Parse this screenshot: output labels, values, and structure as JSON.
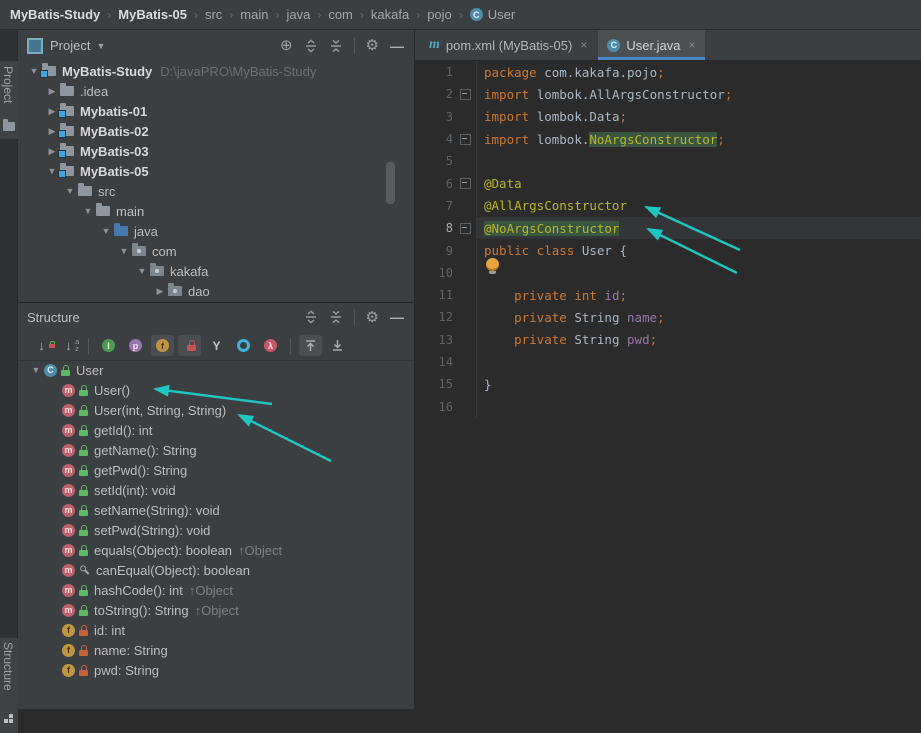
{
  "colors": {
    "accent_underline": "#4A88C7",
    "annotation_arrow": "#1EC5C1",
    "usage_highlight_bg": "#38573E",
    "keyword": "#CC7832",
    "annotation": "#BBB529",
    "field": "#9876AA"
  },
  "titlebar": {
    "breadcrumbs": [
      {
        "label": "MyBatis-Study",
        "bold": true
      },
      {
        "label": "MyBatis-05",
        "bold": true
      },
      {
        "label": "src"
      },
      {
        "label": "main"
      },
      {
        "label": "java"
      },
      {
        "label": "com"
      },
      {
        "label": "kakafa"
      },
      {
        "label": "pojo"
      },
      {
        "label": "User",
        "icon": "class"
      }
    ]
  },
  "tool_stripe": {
    "top_tab": "Project",
    "bottom_tab": "Structure"
  },
  "project_panel": {
    "title": "Project",
    "header_icons": [
      "locate-icon",
      "expand-all-icon",
      "collapse-all-icon",
      "separator",
      "settings-icon",
      "hide-icon"
    ],
    "tree": [
      {
        "label": "MyBatis-Study",
        "suffix": "D:\\javaPRO\\MyBatis-Study",
        "icon": "module",
        "state": "expanded",
        "level": 0,
        "bold": true
      },
      {
        "label": ".idea",
        "icon": "folder",
        "state": "collapsed",
        "level": 1
      },
      {
        "label": "Mybatis-01",
        "icon": "module",
        "state": "collapsed",
        "level": 1,
        "bold": true
      },
      {
        "label": "MyBatis-02",
        "icon": "module",
        "state": "collapsed",
        "level": 1,
        "bold": true
      },
      {
        "label": "MyBatis-03",
        "icon": "module",
        "state": "collapsed",
        "level": 1,
        "bold": true
      },
      {
        "label": "MyBatis-05",
        "icon": "module",
        "state": "expanded",
        "level": 1,
        "bold": true
      },
      {
        "label": "src",
        "icon": "folder",
        "state": "expanded",
        "level": 2
      },
      {
        "label": "main",
        "icon": "folder",
        "state": "expanded",
        "level": 3
      },
      {
        "label": "java",
        "icon": "source-folder",
        "state": "expanded",
        "level": 4
      },
      {
        "label": "com",
        "icon": "package",
        "state": "expanded",
        "level": 5
      },
      {
        "label": "kakafa",
        "icon": "package",
        "state": "expanded",
        "level": 6
      },
      {
        "label": "dao",
        "icon": "package",
        "state": "collapsed",
        "level": 7
      }
    ]
  },
  "structure_panel": {
    "title": "Structure",
    "header_icons": [
      "expand-all-icon",
      "collapse-all-icon",
      "separator",
      "settings-icon",
      "hide-icon"
    ],
    "toolbar": [
      {
        "name": "sort-by-visibility-icon",
        "kind": "sort-vis"
      },
      {
        "name": "sort-alphabetically-icon",
        "kind": "sort-az"
      },
      {
        "name": "separator",
        "kind": "sep"
      },
      {
        "name": "show-inherited-icon",
        "kind": "circle",
        "bg": "#4D9B53",
        "letter": "I",
        "lc": "#E8F2E8"
      },
      {
        "name": "show-properties-icon",
        "kind": "circle",
        "bg": "#9876AA",
        "letter": "p",
        "lc": "#F0E8F5"
      },
      {
        "name": "show-fields-icon",
        "kind": "circle",
        "bg": "#C09542",
        "letter": "f",
        "lc": "#42310B",
        "toggled": true
      },
      {
        "name": "show-non-public-icon",
        "kind": "lock",
        "toggled": true
      },
      {
        "name": "show-anonymous-classes-icon",
        "kind": "y"
      },
      {
        "name": "show-open-classes-icon",
        "kind": "donut"
      },
      {
        "name": "show-lambdas-icon",
        "kind": "circle",
        "bg": "#C8576C",
        "letter": "λ",
        "lc": "#F7E3E8"
      },
      {
        "name": "separator",
        "kind": "sep"
      },
      {
        "name": "autoscroll-to-source-icon",
        "kind": "bar-up",
        "toggled": true
      },
      {
        "name": "autoscroll-from-source-icon",
        "kind": "bar-down"
      }
    ],
    "tree": [
      {
        "label": "User",
        "icon": "class",
        "vis": "public",
        "state": "expanded",
        "level": 0
      },
      {
        "label": "User()",
        "icon": "method",
        "vis": "public",
        "level": 1
      },
      {
        "label": "User(int, String, String)",
        "icon": "method",
        "vis": "public",
        "level": 1
      },
      {
        "label": "getId(): int",
        "icon": "method",
        "vis": "public",
        "level": 1
      },
      {
        "label": "getName(): String",
        "icon": "method",
        "vis": "public",
        "level": 1
      },
      {
        "label": "getPwd(): String",
        "icon": "method",
        "vis": "public",
        "level": 1
      },
      {
        "label": "setId(int): void",
        "icon": "method",
        "vis": "public",
        "level": 1
      },
      {
        "label": "setName(String): void",
        "icon": "method",
        "vis": "public",
        "level": 1
      },
      {
        "label": "setPwd(String): void",
        "icon": "method",
        "vis": "public",
        "level": 1
      },
      {
        "label": "equals(Object): boolean",
        "suffix": "↑Object",
        "icon": "method",
        "vis": "public",
        "level": 1
      },
      {
        "label": "canEqual(Object): boolean",
        "icon": "method",
        "vis": "protected",
        "level": 1
      },
      {
        "label": "hashCode(): int",
        "suffix": "↑Object",
        "icon": "method",
        "vis": "public",
        "level": 1
      },
      {
        "label": "toString(): String",
        "suffix": "↑Object",
        "icon": "method",
        "vis": "public",
        "level": 1
      },
      {
        "label": "id: int",
        "icon": "field",
        "vis": "private",
        "level": 1
      },
      {
        "label": "name: String",
        "icon": "field",
        "vis": "private",
        "level": 1
      },
      {
        "label": "pwd: String",
        "icon": "field",
        "vis": "private",
        "level": 1
      }
    ]
  },
  "editor": {
    "tabs": [
      {
        "label": "pom.xml (MyBatis-05)",
        "icon": "maven",
        "active": false,
        "close": "×"
      },
      {
        "label": "User.java",
        "icon": "class",
        "active": true,
        "close": "×"
      }
    ],
    "current_line": 8,
    "fold_lines": [
      2,
      4,
      6,
      8
    ],
    "bulb_line": 7,
    "code": [
      {
        "n": 1,
        "t": [
          [
            "package ",
            "kw"
          ],
          [
            "com.kakafa.pojo",
            "pl"
          ],
          [
            ";",
            "kw"
          ]
        ]
      },
      {
        "n": 2,
        "t": [
          [
            "import ",
            "kw"
          ],
          [
            "lombok.AllArgsConstructor",
            "pl"
          ],
          [
            ";",
            "kw"
          ]
        ]
      },
      {
        "n": 3,
        "t": [
          [
            "import ",
            "kw"
          ],
          [
            "lombok.Data",
            "pl"
          ],
          [
            ";",
            "kw"
          ]
        ]
      },
      {
        "n": 4,
        "t": [
          [
            "import ",
            "kw"
          ],
          [
            "lombok.",
            "pl"
          ],
          [
            "NoArgsConstructor",
            "annhl"
          ],
          [
            ";",
            "kw"
          ]
        ]
      },
      {
        "n": 5,
        "t": []
      },
      {
        "n": 6,
        "t": [
          [
            "@Data",
            "ann"
          ]
        ]
      },
      {
        "n": 7,
        "t": [
          [
            "@AllArgsConstructor",
            "ann"
          ]
        ]
      },
      {
        "n": 8,
        "t": [
          [
            "@NoArgsConstructor",
            "annhl"
          ]
        ]
      },
      {
        "n": 9,
        "t": [
          [
            "public class ",
            "kw"
          ],
          [
            "User",
            "pl"
          ],
          [
            " {",
            "pl"
          ]
        ]
      },
      {
        "n": 10,
        "t": []
      },
      {
        "n": 11,
        "t": [
          [
            "    ",
            "pl"
          ],
          [
            "private int ",
            "kw"
          ],
          [
            "id",
            "fld"
          ],
          [
            ";",
            "kw"
          ]
        ]
      },
      {
        "n": 12,
        "t": [
          [
            "    ",
            "pl"
          ],
          [
            "private ",
            "kw"
          ],
          [
            "String ",
            "pl"
          ],
          [
            "name",
            "fld"
          ],
          [
            ";",
            "kw"
          ]
        ]
      },
      {
        "n": 13,
        "t": [
          [
            "    ",
            "pl"
          ],
          [
            "private ",
            "kw"
          ],
          [
            "String ",
            "pl"
          ],
          [
            "pwd",
            "fld"
          ],
          [
            ";",
            "kw"
          ]
        ]
      },
      {
        "n": 14,
        "t": []
      },
      {
        "n": 15,
        "t": [
          [
            "}",
            "pl"
          ]
        ]
      },
      {
        "n": 16,
        "t": []
      }
    ]
  },
  "annotations": {
    "arrows": [
      {
        "id": "arrow-to-noargs-constructor-item"
      },
      {
        "id": "arrow-to-allargs-constructor-item"
      },
      {
        "id": "arrow-to-allargs-annotation"
      },
      {
        "id": "arrow-to-noargs-annotation"
      }
    ]
  }
}
